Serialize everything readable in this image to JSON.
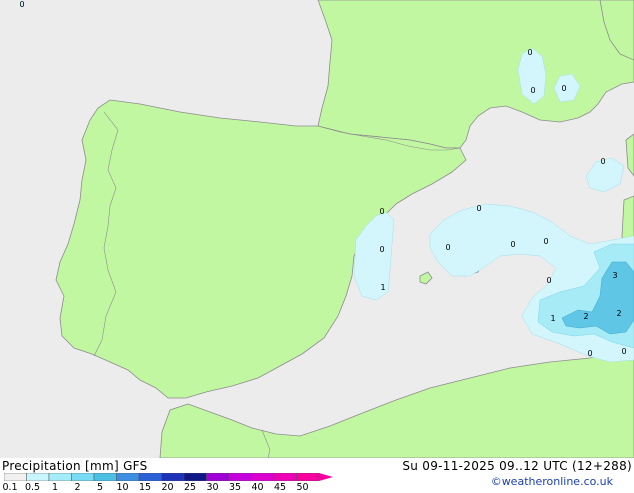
{
  "map": {
    "values": [
      "0",
      "0",
      "0",
      "0",
      "0",
      "0",
      "0",
      "0",
      "0",
      "0",
      "0",
      "0",
      "3",
      "1",
      "2",
      "2",
      "0",
      "0"
    ]
  },
  "footer": {
    "title": "Precipitation [mm] GFS",
    "run": "Su 09-11-2025 09..12 UTC (12+288)",
    "credit": "©weatheronline.co.uk"
  },
  "legend": {
    "labels": [
      "0.1",
      "0.5",
      "1",
      "2",
      "5",
      "10",
      "15",
      "20",
      "25",
      "30",
      "35",
      "40",
      "45",
      "50"
    ],
    "colors": [
      "#f0f0f0",
      "#c8f5ff",
      "#a5ecfa",
      "#7adcf4",
      "#4cbfe5",
      "#3d8ee0",
      "#2a5fd6",
      "#1c32b8",
      "#101888",
      "#a000d8",
      "#c400dc",
      "#dc00d0",
      "#ee00b8",
      "#f800a0"
    ]
  },
  "colors": {
    "land": "#c2f7a2",
    "sea": "#ececec",
    "border": "#8c8c8c",
    "precip_light": "#d2f6fb",
    "precip_mid": "#a6ebf6",
    "precip_heavy": "#5fc6e6"
  }
}
